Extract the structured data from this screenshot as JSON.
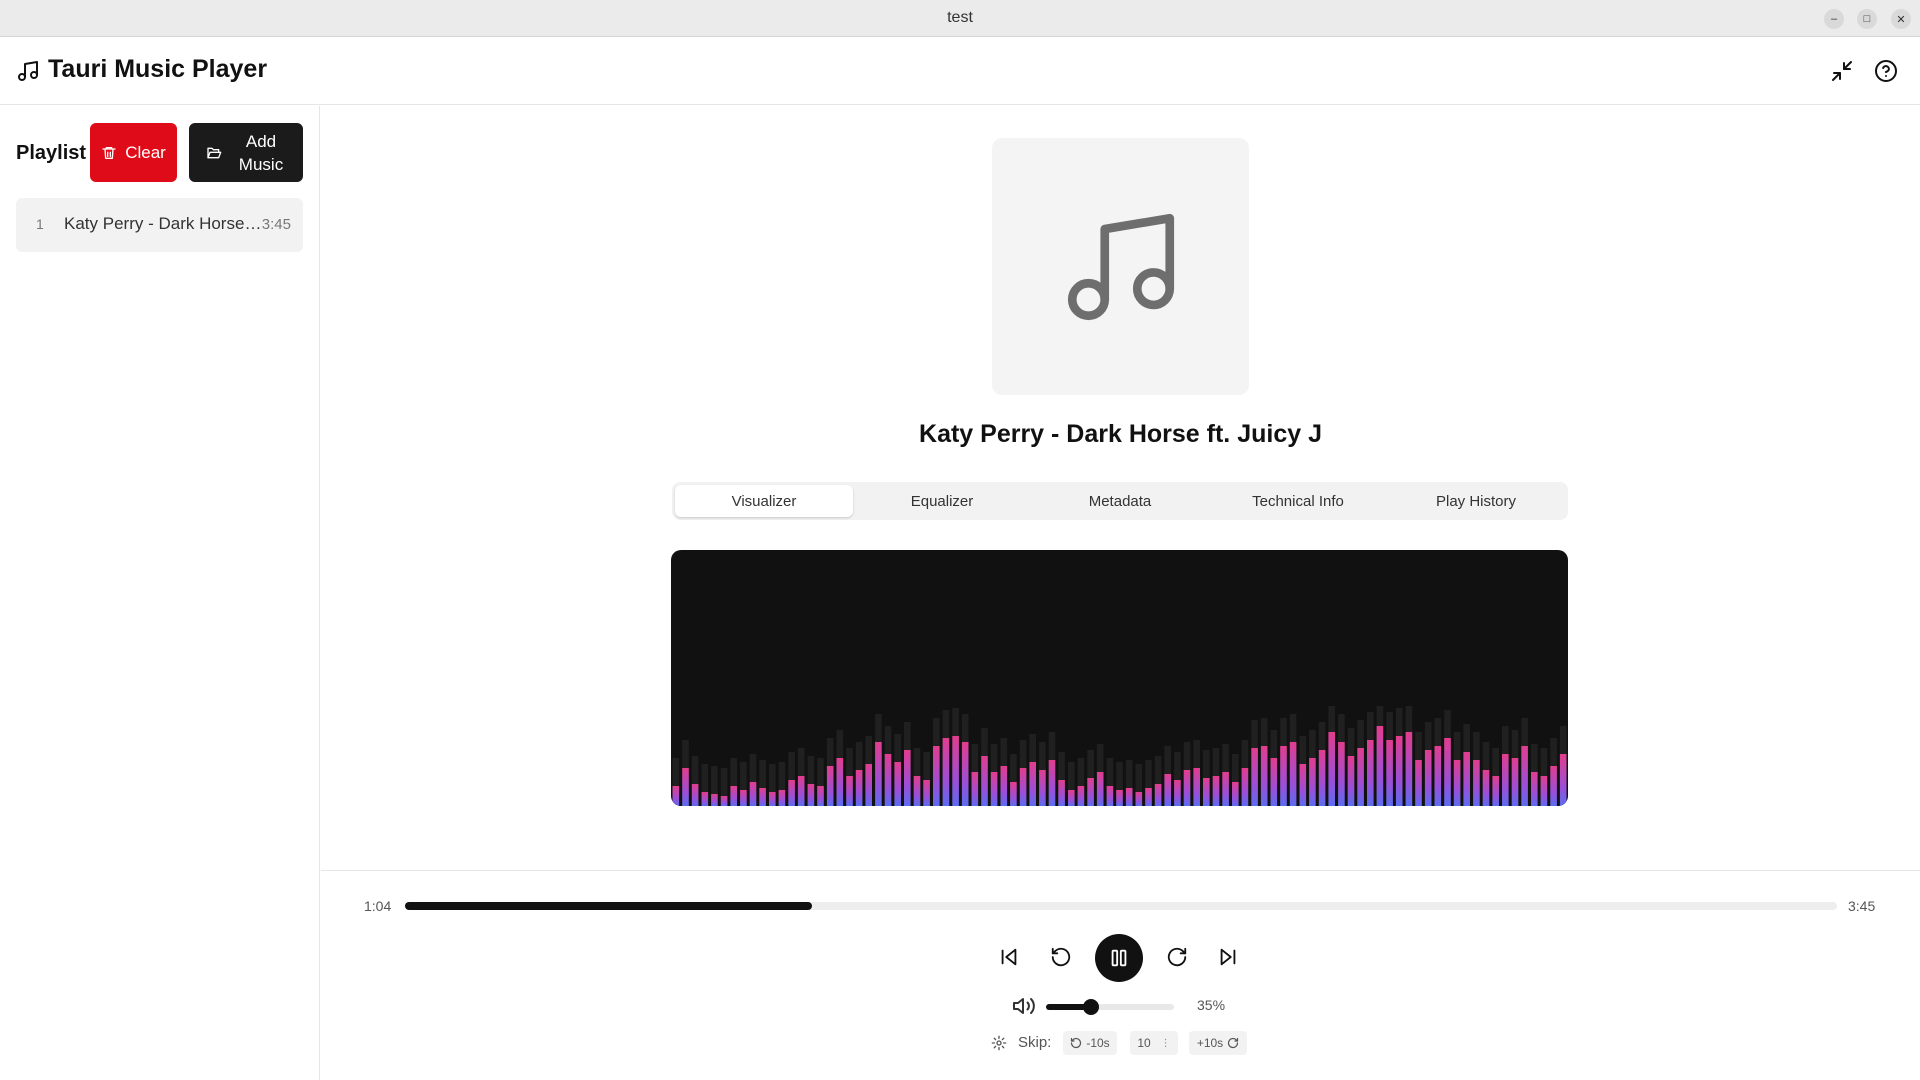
{
  "window": {
    "title": "test"
  },
  "header": {
    "app_title": "Tauri Music Player"
  },
  "sidebar": {
    "playlist_label": "Playlist",
    "clear_label": "Clear",
    "add_music_label": "Add Music",
    "tracks": [
      {
        "index": "1",
        "title": "Katy Perry - Dark Horse ft. Juicy J",
        "duration": "3:45"
      }
    ]
  },
  "now_playing": {
    "title": "Katy Perry - Dark Horse ft. Juicy J"
  },
  "tabs": [
    "Visualizer",
    "Equalizer",
    "Metadata",
    "Technical Info",
    "Play History"
  ],
  "active_tab": "Visualizer",
  "visualizer": {
    "levels": [
      0.2,
      0.38,
      0.22,
      0.14,
      0.12,
      0.1,
      0.2,
      0.16,
      0.24,
      0.18,
      0.14,
      0.16,
      0.26,
      0.3,
      0.22,
      0.2,
      0.4,
      0.48,
      0.3,
      0.36,
      0.42,
      0.64,
      0.52,
      0.44,
      0.56,
      0.3,
      0.26,
      0.6,
      0.68,
      0.7,
      0.64,
      0.34,
      0.5,
      0.34,
      0.4,
      0.24,
      0.38,
      0.44,
      0.36,
      0.46,
      0.26,
      0.16,
      0.2,
      0.28,
      0.34,
      0.2,
      0.16,
      0.18,
      0.14,
      0.18,
      0.22,
      0.32,
      0.26,
      0.36,
      0.38,
      0.28,
      0.3,
      0.34,
      0.24,
      0.38,
      0.58,
      0.6,
      0.48,
      0.6,
      0.64,
      0.42,
      0.48,
      0.56,
      0.74,
      0.64,
      0.5,
      0.58,
      0.66,
      0.8,
      0.66,
      0.7,
      0.74,
      0.46,
      0.56,
      0.6,
      0.68,
      0.46,
      0.54,
      0.46,
      0.36,
      0.3,
      0.52,
      0.48,
      0.6,
      0.34,
      0.3,
      0.4,
      0.52
    ]
  },
  "player": {
    "current_time": "1:04",
    "total_time": "3:45",
    "progress_fraction": 0.2844,
    "volume_percent": "35%",
    "volume_fraction": 0.35,
    "skip_label": "Skip:",
    "skip_back_label": "-10s",
    "skip_amount": "10",
    "skip_forward_label": "+10s"
  },
  "colors": {
    "clear_red": "#e00b18",
    "bar_blue": "#5b6cf0",
    "bar_pink": "#e23d8e"
  }
}
